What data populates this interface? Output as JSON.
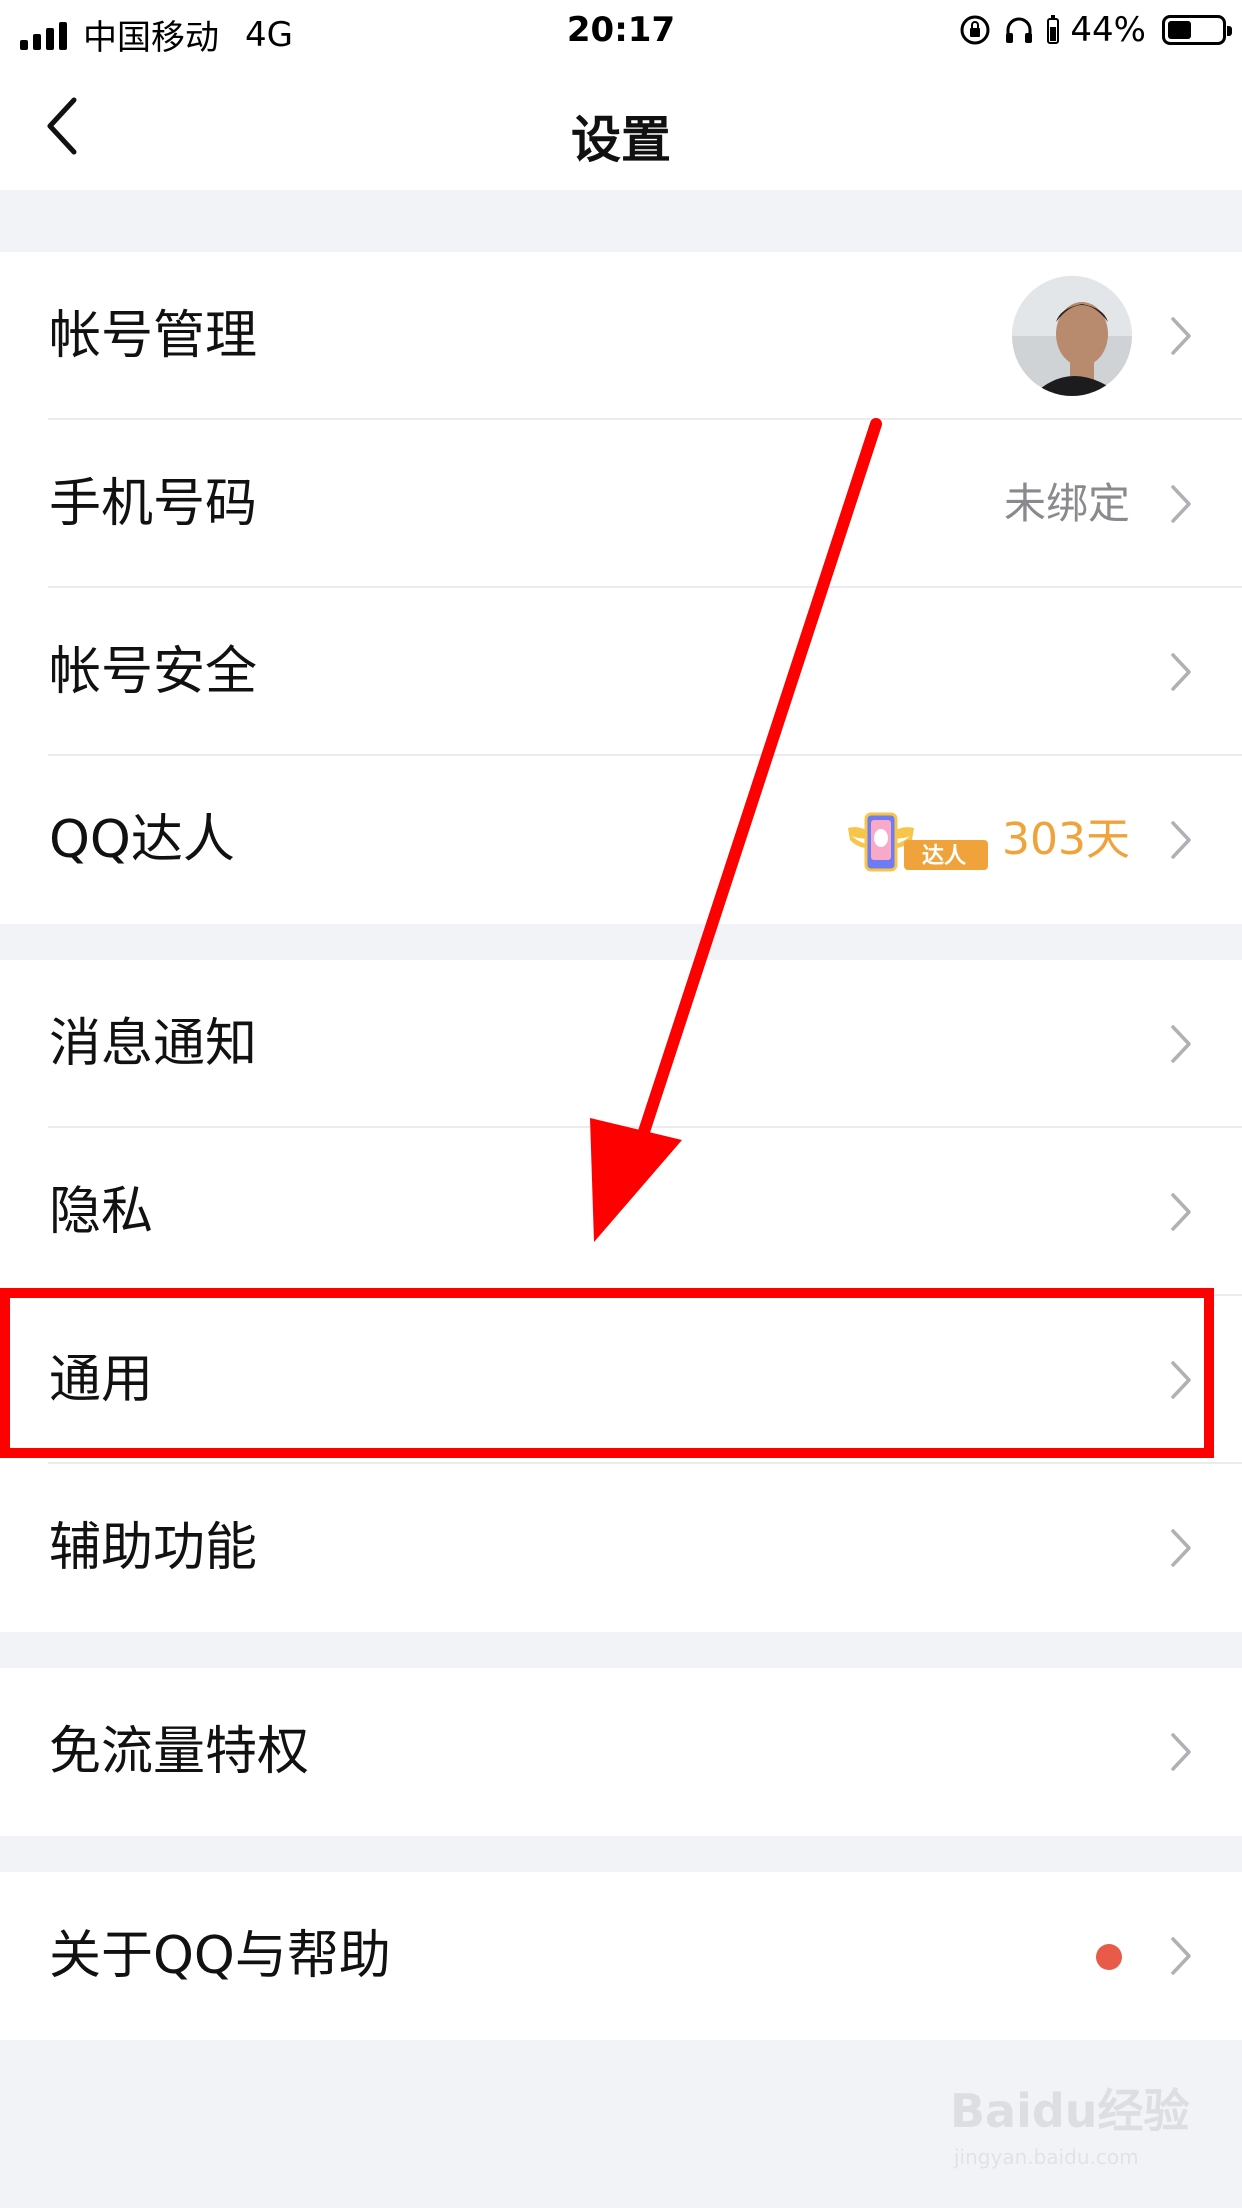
{
  "status_bar": {
    "carrier": "中国移动",
    "network": "4G",
    "time": "20:17",
    "battery_percent_text": "44%",
    "battery_level": 0.44
  },
  "nav": {
    "title": "设置"
  },
  "groups": {
    "account": {
      "items": [
        {
          "label": "帐号管理",
          "value": ""
        },
        {
          "label": "手机号码",
          "value": "未绑定"
        },
        {
          "label": "帐号安全",
          "value": ""
        },
        {
          "label": "QQ达人",
          "value": "303天",
          "badge_text": "达人"
        }
      ]
    },
    "main": {
      "items": [
        {
          "label": "消息通知"
        },
        {
          "label": "隐私"
        },
        {
          "label": "通用"
        },
        {
          "label": "辅助功能"
        }
      ]
    },
    "traffic": {
      "items": [
        {
          "label": "免流量特权"
        }
      ]
    },
    "about": {
      "items": [
        {
          "label": "关于QQ与帮助"
        }
      ]
    }
  },
  "annotation": {
    "highlighted_item": "通用",
    "color": "#ff0000"
  },
  "watermark": {
    "logo": "Baidu经验",
    "url": "jingyan.baidu.com"
  },
  "colors": {
    "background": "#f2f3f6",
    "value_gray": "#8a8a8e",
    "talent_orange": "#f0a23b",
    "dot_red": "#e75b48"
  }
}
